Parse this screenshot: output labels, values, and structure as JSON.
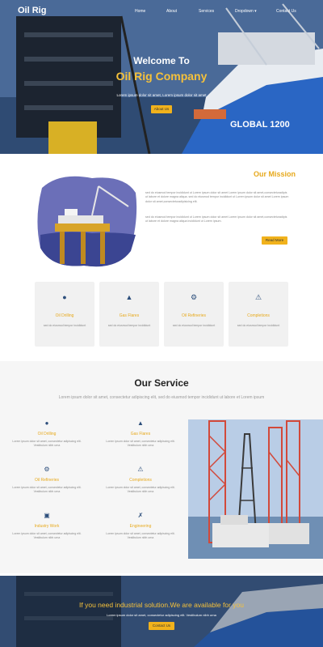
{
  "brand": {
    "logo": "Oil Rig"
  },
  "nav": {
    "items": [
      "Home",
      "About",
      "Services",
      "Dropdown ▾",
      "Contact Us"
    ]
  },
  "hero": {
    "title_line1": "Welcome To",
    "title_line2": "Oil Rig Company",
    "subtitle": "Lorem ipsum dolor sit amet, Lorem ipsum dolor sit amet",
    "button": "About Us",
    "ship_label": "GLOBAL 1200"
  },
  "mission": {
    "title": "Our Mission",
    "paragraphs": [
      "sed do eiusmod tempor incididunt ut Lorem ipsum dolor sit amet Lorem ipsum dolor sit amet,consecteturadipis ut labore et dolore magna aliqua. sed do eiusmod tempor incididunt ut Lorem ipsum dolor sit amet Lorem ipsum dolor sit amet,consecteturadipisicing elit.",
      "sed do eiusmod tempor incididunt ut Lorem ipsum dolor sit amet Lorem ipsum dolor sit amet,consecteturadipis ut labore et dolore magna aliqua incididunt ut Lorem ipsum."
    ],
    "button": "Read More"
  },
  "features": [
    {
      "icon": "drop-icon",
      "title": "Oil Drilling",
      "desc": "sed do eiusmod tempor incididunt"
    },
    {
      "icon": "fire-icon",
      "title": "Gas Flares",
      "desc": "sed do eiusmod tempor incididunt"
    },
    {
      "icon": "cogs-icon",
      "title": "Oil Refineries",
      "desc": "sed do eiusmod tempor incididunt"
    },
    {
      "icon": "warning-icon",
      "title": "Completions",
      "desc": "sed do eiusmod tempor incididunt"
    }
  ],
  "service": {
    "title": "Our Service",
    "subtitle": "Lorem ipsum dolor sit amet, consectetur adipiscing elit, sed do eiusmod tempor incididunt ut labore et Lorem ipsum",
    "items": [
      {
        "icon": "drop-icon",
        "title": "Oil Drilling",
        "desc": "Lorem ipsum dolor sit amet, consectetur adipiscing elit. Vestibulum nibh urna"
      },
      {
        "icon": "fire-extinguisher-icon",
        "title": "Gas Flares",
        "desc": "Lorem ipsum dolor sit amet, consectetur adipiscing elit. Vestibulum nibh urna"
      },
      {
        "icon": "cogs-icon",
        "title": "Oil Refineries",
        "desc": "Lorem ipsum dolor sit amet, consectetur adipiscing elit. Vestibulum nibh urna"
      },
      {
        "icon": "warning-icon",
        "title": "Completions",
        "desc": "Lorem ipsum dolor sit amet, consectetur adipiscing elit. Vestibulum nibh urna"
      },
      {
        "icon": "factory-icon",
        "title": "Industry Work",
        "desc": "Lorem ipsum dolor sit amet, consectetur adipiscing elit. Vestibulum nibh urna"
      },
      {
        "icon": "wrench-icon",
        "title": "Engineering",
        "desc": "Lorem ipsum dolor sit amet, consectetur adipiscing elit. Vestibulum nibh urna"
      }
    ]
  },
  "cta": {
    "title": "If you need industrial solution.We are available for you",
    "subtitle": "Lorem ipsum dolor sit amet, consectetur adipiscing elit. Vestibulum nibh urna",
    "button": "Contact Us"
  },
  "colors": {
    "accent": "#f1b21c",
    "heading_accent": "#e7a91c",
    "icon": "#2d4f7c"
  }
}
